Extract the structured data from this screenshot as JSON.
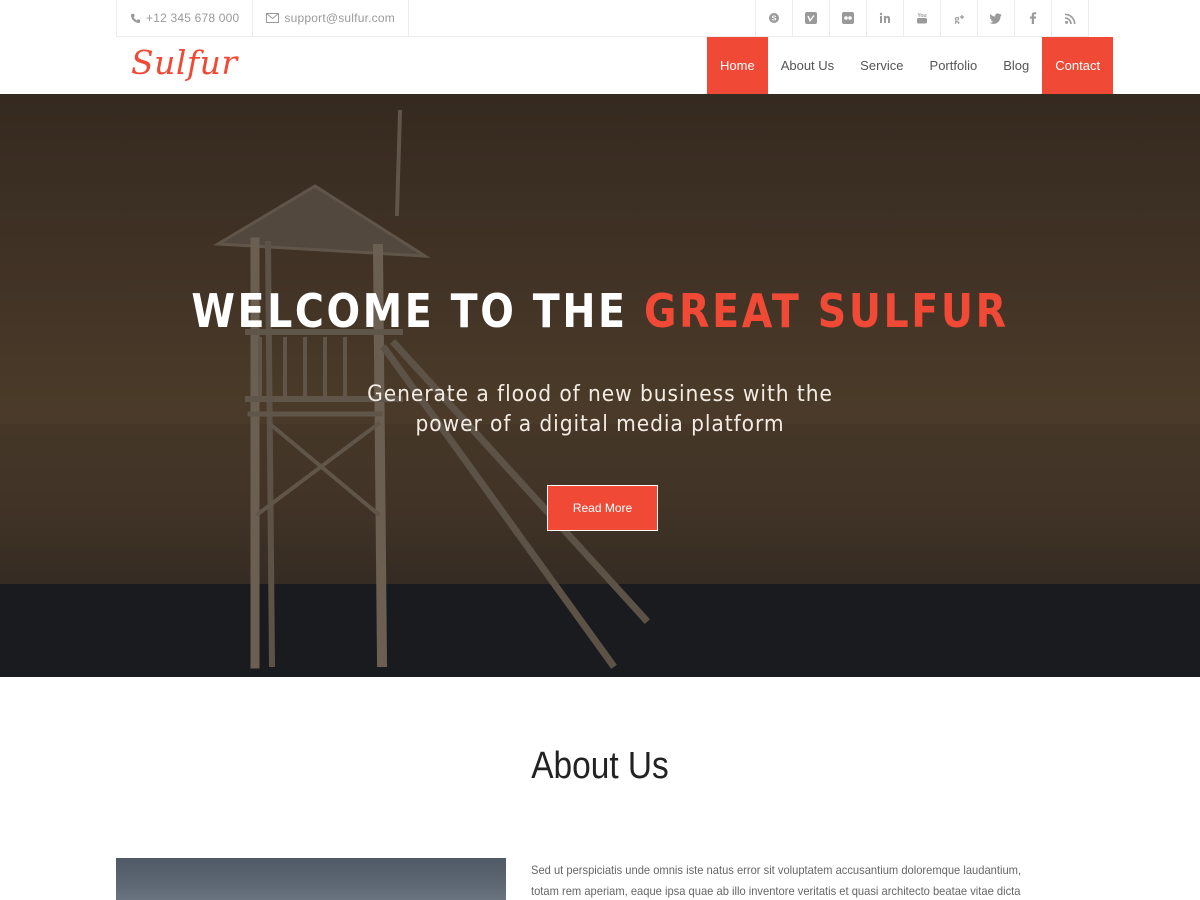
{
  "topbar": {
    "phone": "+12 345 678 000",
    "email": "support@sulfur.com",
    "social": [
      "skype-icon",
      "vimeo-icon",
      "flickr-icon",
      "linkedin-icon",
      "youtube-icon",
      "google-plus-icon",
      "twitter-icon",
      "facebook-icon",
      "rss-icon"
    ]
  },
  "brand": {
    "logo": "Sulfur",
    "accent_color": "#f04a37"
  },
  "nav": {
    "items": [
      {
        "label": "Home",
        "active": true
      },
      {
        "label": "About Us"
      },
      {
        "label": "Service"
      },
      {
        "label": "Portfolio"
      },
      {
        "label": "Blog"
      },
      {
        "label": "Contact",
        "highlight": true
      }
    ]
  },
  "hero": {
    "title_main": "WELCOME TO THE ",
    "title_accent": "GREAT SULFUR",
    "subtitle_line1": "Generate a flood of new business with the",
    "subtitle_line2": "power of a digital media platform",
    "button": "Read More"
  },
  "about": {
    "title": "About Us",
    "text": "Sed ut perspiciatis unde omnis iste natus error sit voluptatem accusantium doloremque laudantium, totam rem aperiam, eaque ipsa quae ab illo inventore veritatis et quasi architecto beatae vitae dicta sunt explicabo. Sed ut"
  }
}
